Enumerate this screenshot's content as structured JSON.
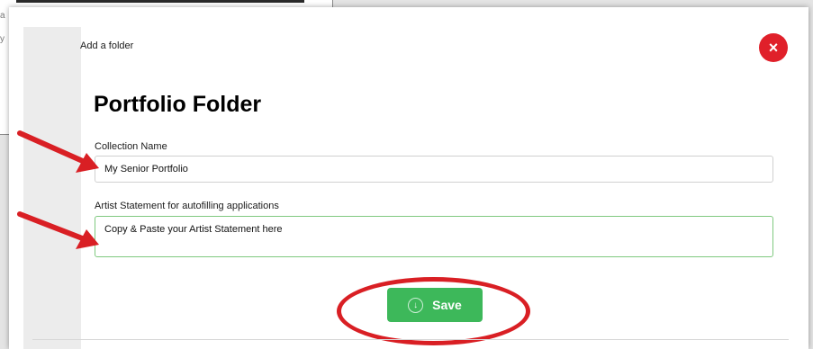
{
  "dialog": {
    "heading": "Add a folder",
    "title": "Portfolio Folder",
    "close_label": "×"
  },
  "form": {
    "collection_name": {
      "label": "Collection Name",
      "value": "My Senior Portfolio"
    },
    "artist_statement": {
      "label": "Artist Statement for autofilling applications",
      "value": "Copy & Paste your Artist Statement here"
    },
    "save_label": "Save"
  },
  "icons": {
    "close": "close-icon",
    "save": "download-circle-icon",
    "annotation": "red-arrow-icon"
  },
  "colors": {
    "save_button": "#3db85a",
    "close_button": "#e0202a",
    "annotation_red": "#d91f24",
    "statement_border": "#7fc97f"
  }
}
